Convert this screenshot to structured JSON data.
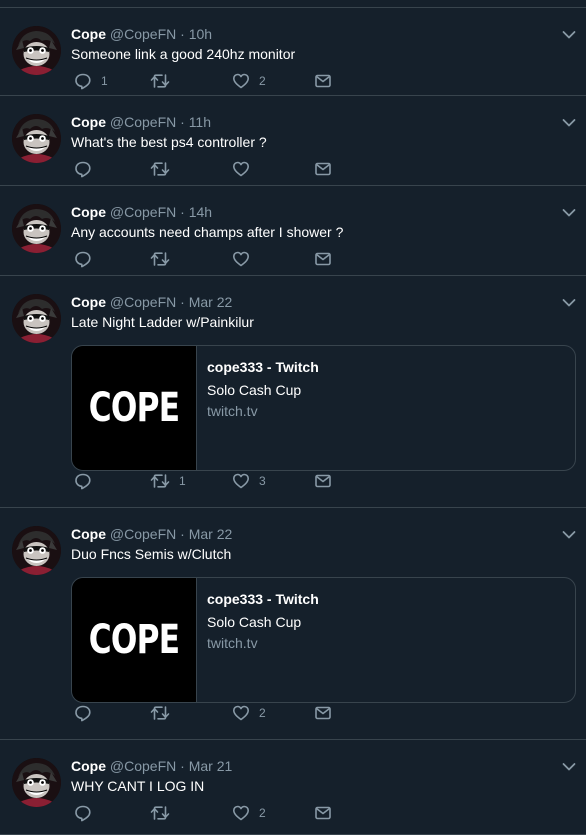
{
  "colors": {
    "background": "#15202b",
    "border": "#38444d",
    "secondary_text": "#8899a6",
    "primary_text": "#ffffff"
  },
  "tweets": [
    {
      "name": "Cope",
      "handle": "@CopeFN",
      "separator": "·",
      "time": "10h",
      "text": "Someone link a good 240hz monitor",
      "reply_count": "1",
      "retweet_count": "",
      "like_count": "2"
    },
    {
      "name": "Cope",
      "handle": "@CopeFN",
      "separator": "·",
      "time": "11h",
      "text": "What's the best ps4 controller ?",
      "reply_count": "",
      "retweet_count": "",
      "like_count": ""
    },
    {
      "name": "Cope",
      "handle": "@CopeFN",
      "separator": "·",
      "time": "14h",
      "text": "Any accounts need champs after I shower ?",
      "reply_count": "",
      "retweet_count": "",
      "like_count": ""
    },
    {
      "name": "Cope",
      "handle": "@CopeFN",
      "separator": "·",
      "time": "Mar 22",
      "text": "Late Night Ladder w/Painkilur",
      "reply_count": "",
      "retweet_count": "1",
      "like_count": "3",
      "card": {
        "thumb_text": "COPE",
        "title": "cope333 - Twitch",
        "description": "Solo Cash Cup",
        "domain": "twitch.tv"
      }
    },
    {
      "name": "Cope",
      "handle": "@CopeFN",
      "separator": "·",
      "time": "Mar 22",
      "text": "Duo Fncs Semis w/Clutch",
      "reply_count": "",
      "retweet_count": "",
      "like_count": "2",
      "card": {
        "thumb_text": "COPE",
        "title": "cope333 - Twitch",
        "description": "Solo Cash Cup",
        "domain": "twitch.tv"
      }
    },
    {
      "name": "Cope",
      "handle": "@CopeFN",
      "separator": "·",
      "time": "Mar 21",
      "text": "WHY CANT I LOG IN",
      "reply_count": "",
      "retweet_count": "",
      "like_count": "2"
    }
  ],
  "icons": {
    "reply": "reply-icon",
    "retweet": "retweet-icon",
    "like": "heart-icon",
    "dm": "envelope-icon",
    "more": "chevron-down-icon",
    "avatar": "avatar"
  }
}
